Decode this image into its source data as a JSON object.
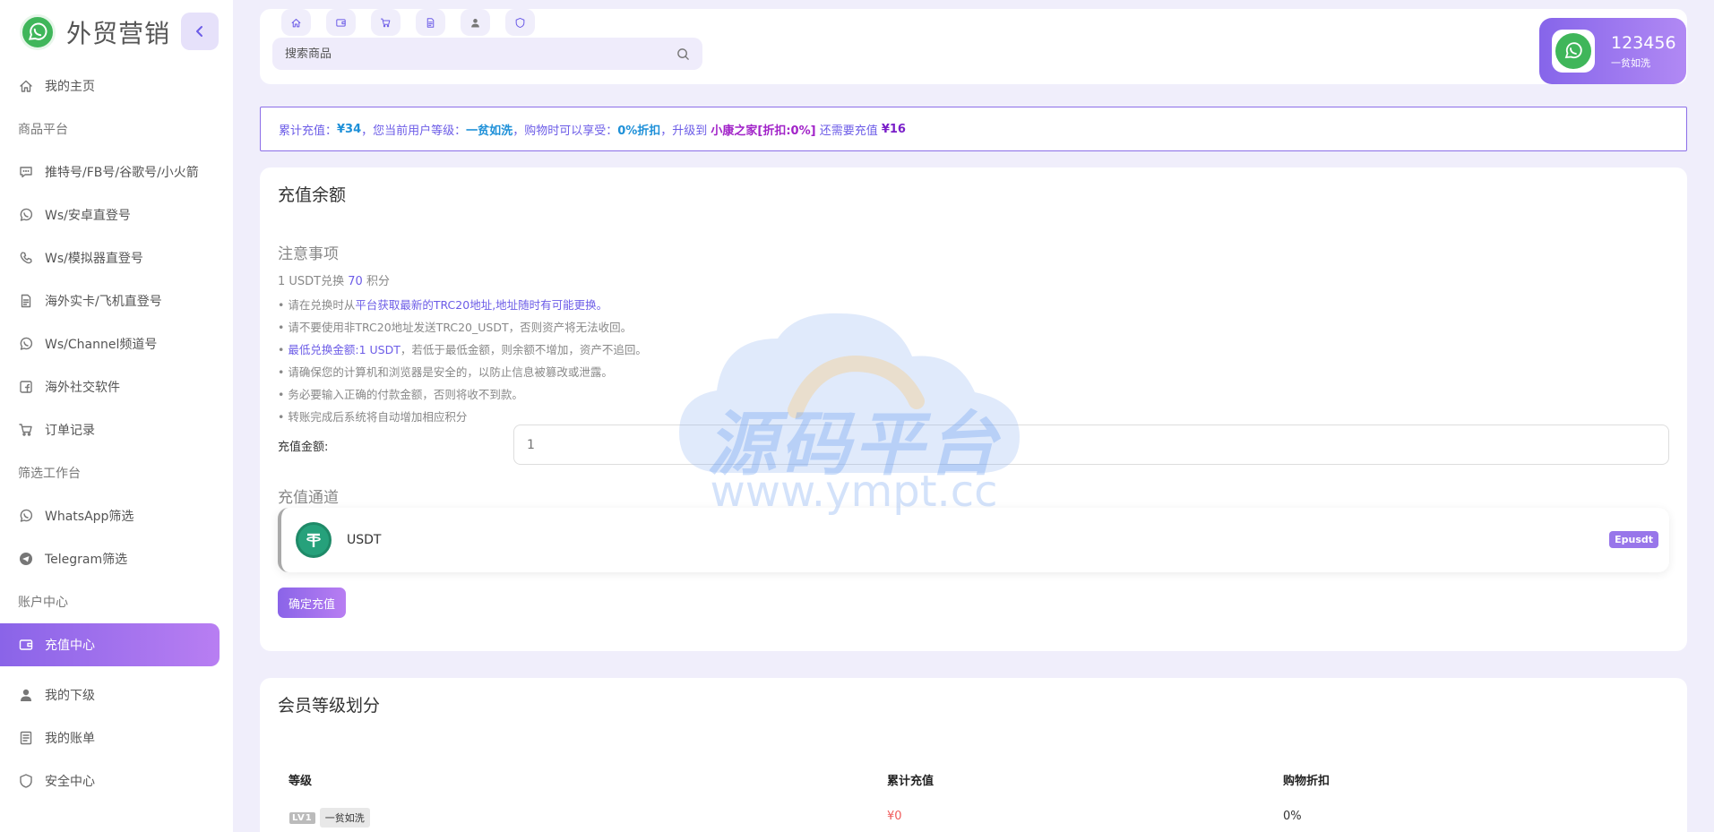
{
  "app": {
    "name": "外贸营销"
  },
  "sidebar": {
    "items": [
      {
        "type": "item",
        "label": "我的主页",
        "icon": "home-icon",
        "name": "sidebar-item-home"
      },
      {
        "type": "section",
        "label": "商品平台"
      },
      {
        "type": "item",
        "label": "推特号/FB号/谷歌号/小火箭",
        "icon": "chat-icon",
        "name": "sidebar-item-twitter-fb"
      },
      {
        "type": "item",
        "label": "Ws/安卓直登号",
        "icon": "whatsapp-icon",
        "name": "sidebar-item-ws-android"
      },
      {
        "type": "item",
        "label": "Ws/模拟器直登号",
        "icon": "phone-icon",
        "name": "sidebar-item-ws-emulator"
      },
      {
        "type": "item",
        "label": "海外实卡/飞机直登号",
        "icon": "document-icon",
        "name": "sidebar-item-overseas-card"
      },
      {
        "type": "item",
        "label": "Ws/Channel频道号",
        "icon": "whatsapp-icon",
        "name": "sidebar-item-ws-channel"
      },
      {
        "type": "item",
        "label": "海外社交软件",
        "icon": "facebook-icon",
        "name": "sidebar-item-social-apps"
      },
      {
        "type": "item",
        "label": "订单记录",
        "icon": "cart-icon",
        "name": "sidebar-item-orders"
      },
      {
        "type": "section",
        "label": "筛选工作台"
      },
      {
        "type": "item",
        "label": "WhatsApp筛选",
        "icon": "whatsapp-icon",
        "name": "sidebar-item-whatsapp-filter"
      },
      {
        "type": "item",
        "label": "Telegram筛选",
        "icon": "telegram-icon",
        "name": "sidebar-item-telegram-filter"
      },
      {
        "type": "section",
        "label": "账户中心"
      },
      {
        "type": "item",
        "label": "充值中心",
        "icon": "wallet-icon",
        "name": "sidebar-item-recharge",
        "active": true
      },
      {
        "type": "item",
        "label": "我的下级",
        "icon": "user-icon",
        "name": "sidebar-item-subordinates"
      },
      {
        "type": "item",
        "label": "我的账单",
        "icon": "bill-icon",
        "name": "sidebar-item-bills"
      },
      {
        "type": "item",
        "label": "安全中心",
        "icon": "shield-icon",
        "name": "sidebar-item-security"
      }
    ]
  },
  "topbar": {
    "quick_icons": [
      "home-icon",
      "wallet-icon",
      "cart-icon",
      "document-icon",
      "user-icon",
      "shield-icon"
    ],
    "search_placeholder": "搜索商品"
  },
  "user": {
    "name": "123456",
    "level": "一贫如洗"
  },
  "notice": {
    "p1": "累计充值：",
    "total": "¥34",
    "p2": "，您当前用户等级：",
    "level": "一贫如洗",
    "p3": "，购物时可以享受：",
    "discount": "0%折扣",
    "p4": "，升级到 ",
    "next_level": "小康之家[折扣:0%]",
    "p5": " 还需要充值 ",
    "needed": "¥16"
  },
  "recharge": {
    "title": "充值余额",
    "notes_title": "注意事项",
    "rate_prefix": "1 USDT兑换 ",
    "rate_value": "70",
    "rate_suffix": " 积分",
    "notes": [
      {
        "pre": "• 请在兑换时从",
        "hl": "平台获取最新的TRC20地址,地址随时有可能更换。",
        "post": ""
      },
      {
        "pre": "• 请不要使用非TRC20地址发送TRC20_USDT，否则资产将无法收回。",
        "hl": "",
        "post": ""
      },
      {
        "pre": "• ",
        "hl": "最低兑换金额:1 USDT",
        "post": "，若低于最低金额，则余额不增加，资产不追回。"
      },
      {
        "pre": "• 请确保您的计算机和浏览器是安全的，以防止信息被篡改或泄露。",
        "hl": "",
        "post": ""
      },
      {
        "pre": "• 务必要输入正确的付款金额，否则将收不到款。",
        "hl": "",
        "post": ""
      },
      {
        "pre": "• 转账完成后系统将自动增加相应积分",
        "hl": "",
        "post": ""
      }
    ],
    "amount_label": "充值金额:",
    "amount_placeholder": "1",
    "channel_title": "充值通道",
    "channel": {
      "name": "USDT",
      "badge": "Epusdt",
      "icon": "usdt-icon"
    },
    "confirm_label": "确定充值"
  },
  "watermark": {
    "text": "源码平台",
    "url": "www.ympt.cc"
  },
  "levels": {
    "title": "会员等级划分",
    "columns": [
      "等级",
      "累计充值",
      "购物折扣"
    ],
    "rows": [
      {
        "tag": "LV1",
        "name": "一贫如洗",
        "total": "¥0",
        "discount": "0%"
      }
    ]
  },
  "colors": {
    "accent": "#8a64e8",
    "accent2": "#b87ef2",
    "brand_green": "#3fb65a",
    "usdt_green": "#26a17b"
  }
}
